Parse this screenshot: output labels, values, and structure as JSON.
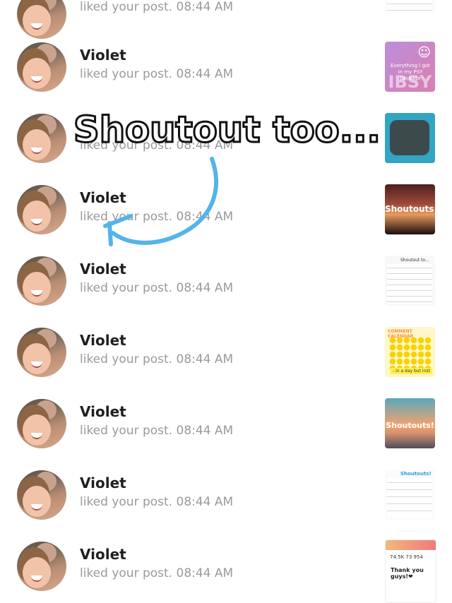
{
  "notifications": [
    {
      "name": "",
      "action": "liked your post.",
      "time": "08:44 AM",
      "thumbnail": "list-screenshot-icon"
    },
    {
      "name": "Violet",
      "action": "liked your post.",
      "time": "08:44 AM",
      "thumbnail": "purple-post-icon",
      "thumb_text": "Everything I got in my PSY package",
      "thumb_big": "IBSY",
      "thumb_symbol": "☺"
    },
    {
      "name": "",
      "action": "liked your post.",
      "time": "08:44 AM",
      "thumbnail": "blue-plate-icon"
    },
    {
      "name": "Violet",
      "action": "liked your post.",
      "time": "08:44 AM",
      "thumbnail": "sunset-shoutouts-icon",
      "thumb_text": "Shoutouts!"
    },
    {
      "name": "Violet",
      "action": "liked your post.",
      "time": "08:44 AM",
      "thumbnail": "shoutout-list-icon",
      "thumb_text": "Shoutout to..."
    },
    {
      "name": "Violet",
      "action": "liked your post.",
      "time": "08:44 AM",
      "thumbnail": "comment-calendar-icon",
      "thumb_text": "COMMENT CALENDAR",
      "thumb_bottom": "- in a day but inst"
    },
    {
      "name": "Violet",
      "action": "liked your post.",
      "time": "08:44 AM",
      "thumbnail": "beach-shoutouts-icon",
      "thumb_text": "Shoutouts!"
    },
    {
      "name": "Violet",
      "action": "liked your post.",
      "time": "08:44 AM",
      "thumbnail": "shoutout-list-blue-icon",
      "thumb_text": "Shoutouts!"
    },
    {
      "name": "Violet",
      "action": "liked your post.",
      "time": "08:44 AM",
      "thumbnail": "profile-thanks-icon",
      "thumb_stats": "74.5K  73  954",
      "thumb_thanks": "Thank you guys!❤"
    }
  ],
  "overlay": {
    "caption": "Shoutout too...",
    "arrow_color": "#54b4ea",
    "caption_color": "#ffffff",
    "caption_outline": "#111111"
  },
  "colors": {
    "name": "#1f1f1f",
    "meta": "#9a9a9a",
    "background": "#ffffff"
  }
}
